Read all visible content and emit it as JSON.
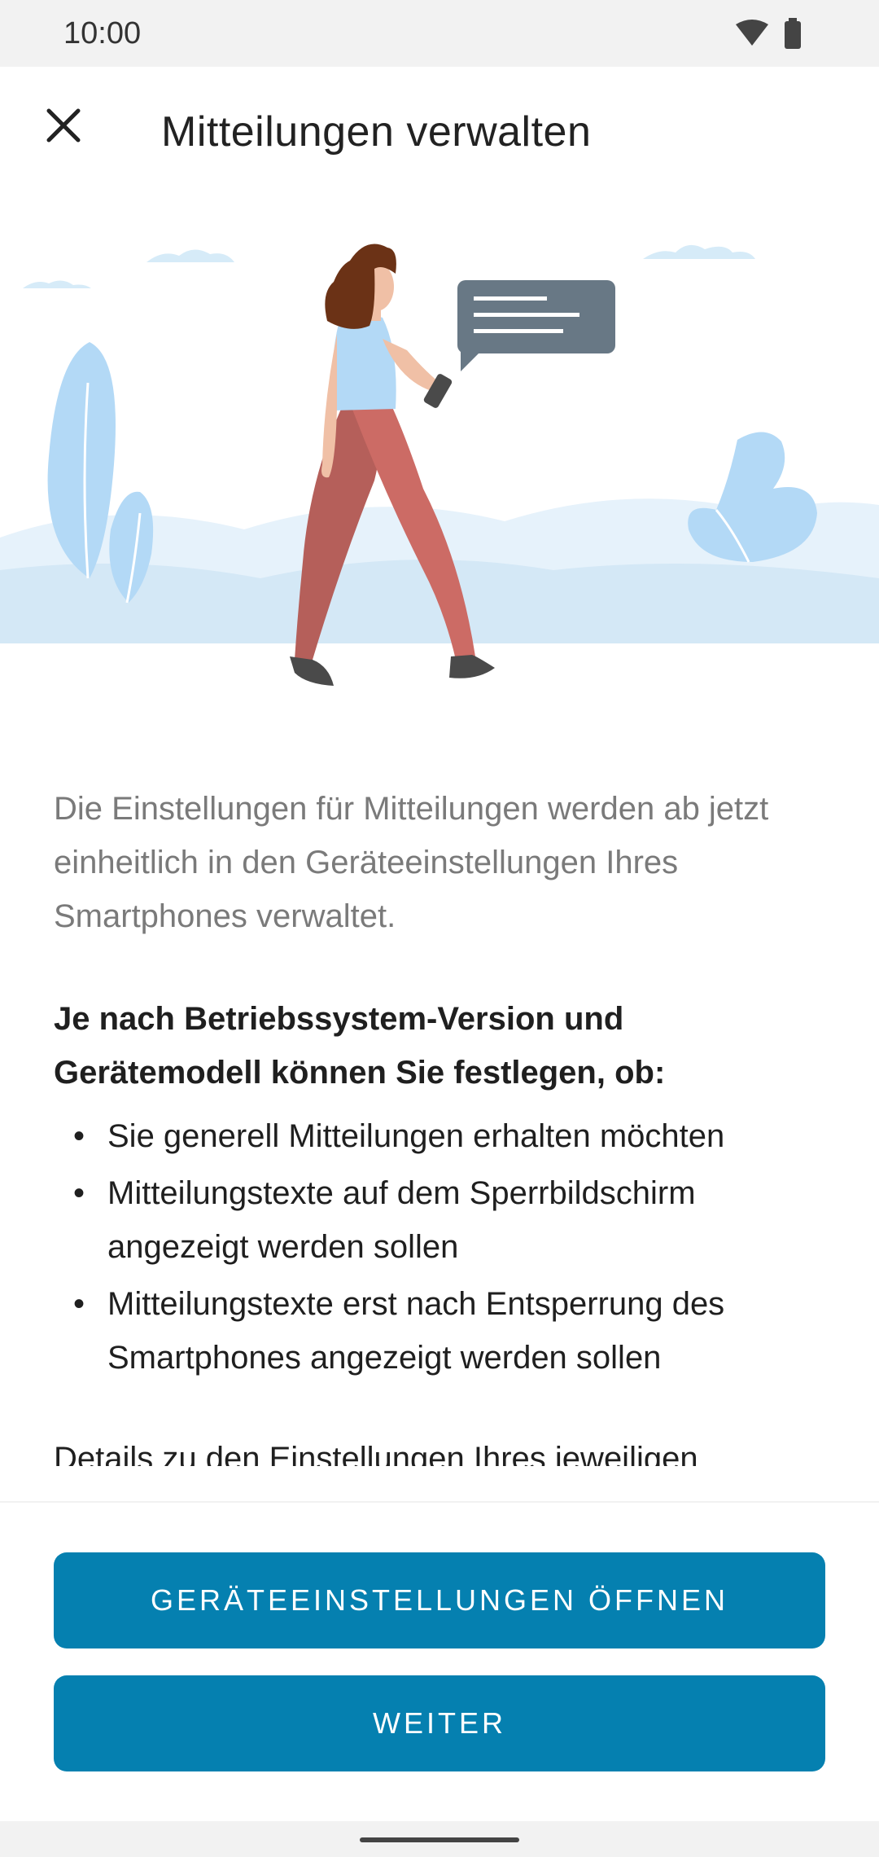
{
  "status_bar": {
    "time": "10:00",
    "icons": [
      "wifi-icon",
      "battery-icon"
    ]
  },
  "header": {
    "close_icon": "close-icon",
    "title": "Mitteilungen verwalten"
  },
  "illustration": {
    "description_icon": "woman-walking-with-phone-illustration"
  },
  "body": {
    "intro": "Die Einstellungen für Mitteilungen werden ab jetzt einheitlich in den Geräteeinstellungen Ihres Smartphones verwaltet.",
    "heading": "Je nach Betriebssystem-Version und Gerätemodell können Sie festlegen, ob:",
    "bullets": [
      "Sie generell Mitteilungen erhalten möchten",
      "Mitteilungstexte auf dem Sperrbildschirm angezeigt werden sollen",
      "Mitteilungstexte erst nach Entsperrung des Smartphones angezeigt werden sollen"
    ],
    "details": "Details zu den Einstellungen Ihres jeweiligen"
  },
  "actions": {
    "open_settings_label": "GERÄTEEINSTELLUNGEN ÖFFNEN",
    "next_label": "WEITER"
  },
  "colors": {
    "primary": "#0580b0",
    "status_bar_bg": "#f2f2f2",
    "intro_text": "#7a7a7a"
  }
}
